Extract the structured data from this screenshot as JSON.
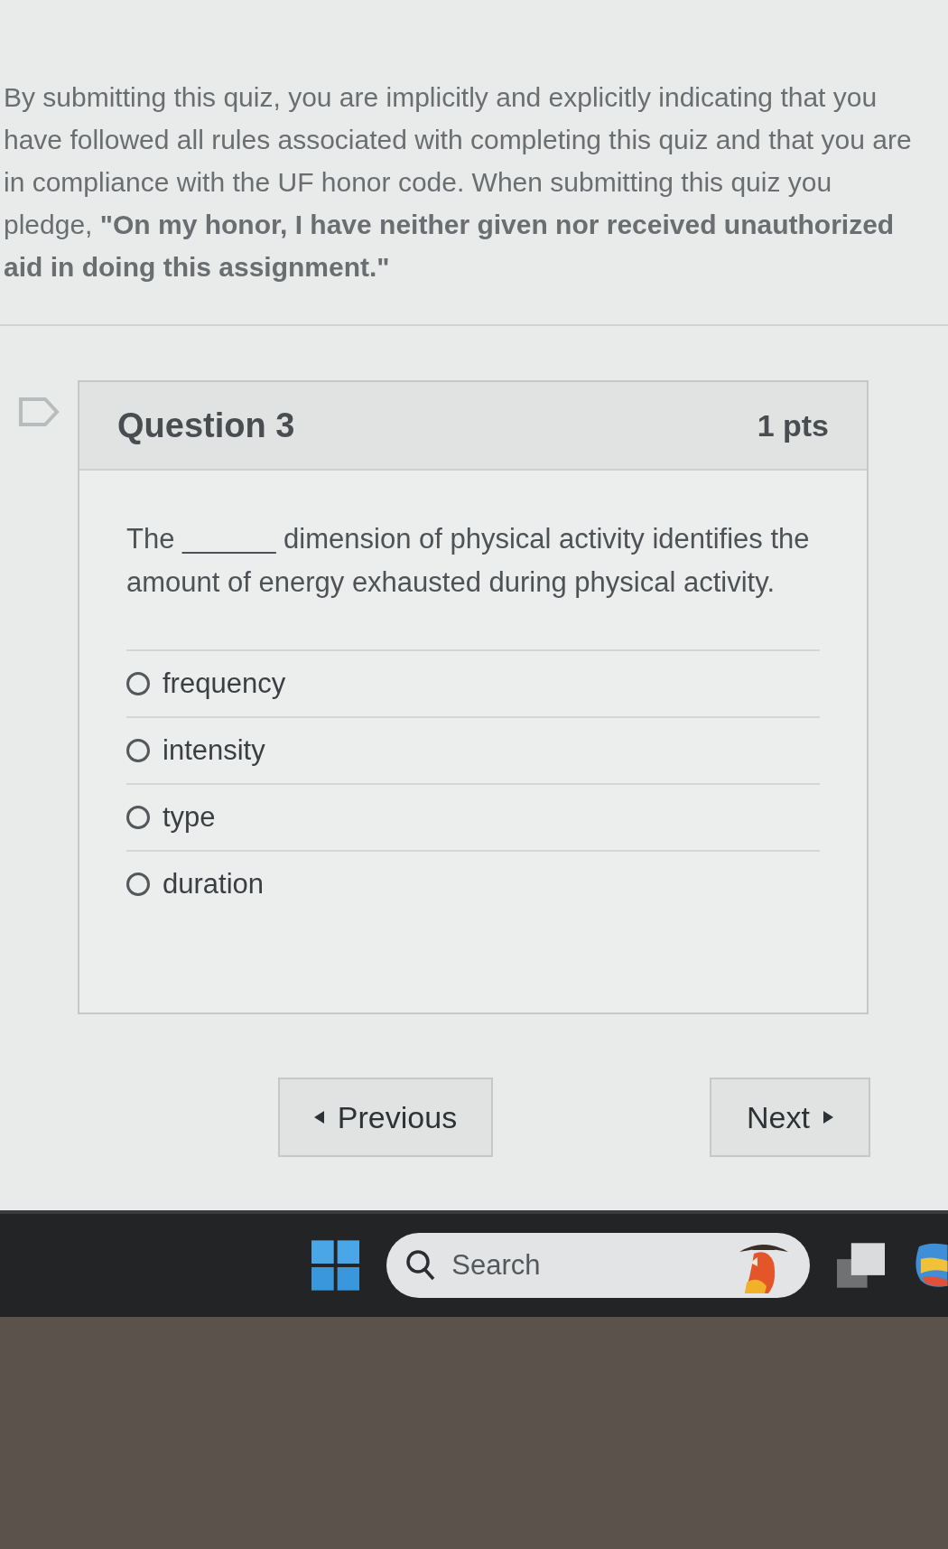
{
  "pledge": "By submitting this quiz, you are implicitly and explicitly indicating that you have followed all rules associated with completing this quiz and that you are in compliance with the UF honor code. When submitting this quiz you pledge, **\"On my honor, I have neither given nor received unauthorized aid in doing this assignment.\"**",
  "question": {
    "title": "Question 3",
    "points": "1 pts",
    "flagged": false,
    "text": "The ______ dimension of physical activity identifies the amount of energy exhausted during physical activity.",
    "answers": [
      {
        "label": "frequency",
        "selected": false
      },
      {
        "label": "intensity",
        "selected": false
      },
      {
        "label": "type",
        "selected": false
      },
      {
        "label": "duration",
        "selected": false
      }
    ]
  },
  "nav": {
    "previous": "Previous",
    "next": "Next"
  },
  "taskbar": {
    "search_placeholder": "Search"
  }
}
